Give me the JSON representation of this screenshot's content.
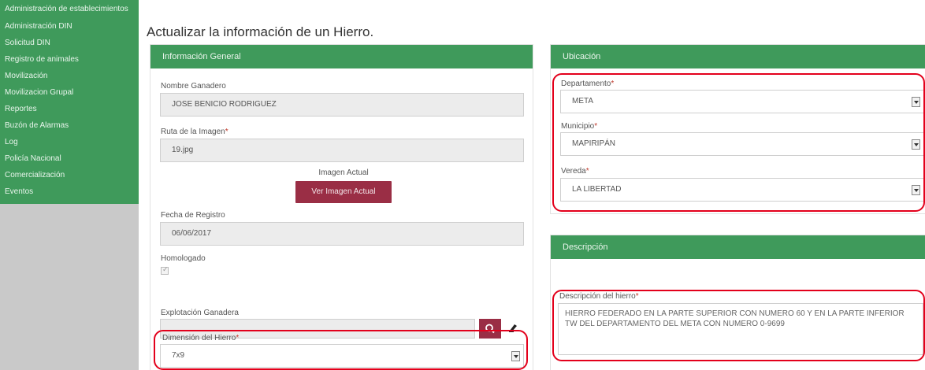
{
  "sidebar": {
    "items": [
      {
        "label": "Administración de establecimientos"
      },
      {
        "label": "Administración DIN"
      },
      {
        "label": "Solicitud DIN"
      },
      {
        "label": "Registro de animales"
      },
      {
        "label": "Movilización"
      },
      {
        "label": "Movilizacion Grupal"
      },
      {
        "label": "Reportes"
      },
      {
        "label": "Buzón de Alarmas"
      },
      {
        "label": "Log"
      },
      {
        "label": "Policía Nacional"
      },
      {
        "label": "Comercialización"
      },
      {
        "label": "Eventos"
      }
    ]
  },
  "page": {
    "title": "Actualizar la información de un Hierro."
  },
  "general": {
    "header": "Información General",
    "owner_label": "Nombre Ganadero",
    "owner_value": "JOSE BENICIO RODRIGUEZ",
    "image_path_label": "Ruta de la Imagen",
    "image_path_value": "19.jpg",
    "current_image_label": "Imagen Actual",
    "view_image_button": "Ver Imagen Actual",
    "register_date_label": "Fecha de Registro",
    "register_date_value": "06/06/2017",
    "homologated_label": "Homologado",
    "farm_label": "Explotación Ganadera",
    "farm_value": "",
    "dimension_label": "Dimensión del Hierro",
    "dimension_value": "7x9"
  },
  "location": {
    "header": "Ubicación",
    "department_label": "Departamento",
    "department_value": "META",
    "municipality_label": "Municipio",
    "municipality_value": "MAPIRIPÁN",
    "village_label": "Vereda",
    "village_value": "LA LIBERTAD"
  },
  "description": {
    "header": "Descripción",
    "label": "Descripción del hierro",
    "value": "HIERRO FEDERADO EN LA PARTE SUPERIOR CON NUMERO 60 Y EN LA PARTE INFERIOR TW DEL DEPARTAMENTO DEL META CON NUMERO 0-9699"
  },
  "required_mark": "*",
  "colors": {
    "primary_green": "#3f9a5b",
    "accent_maroon": "#9a2e45",
    "highlight_red": "#e3001b"
  }
}
